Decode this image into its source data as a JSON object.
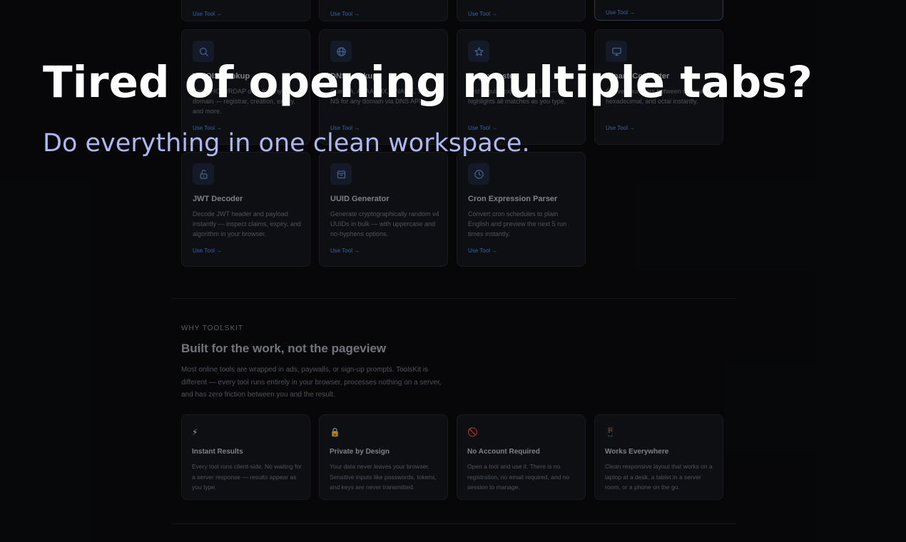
{
  "overlay": {
    "headline": "Tired of opening multiple tabs?",
    "subheadline": "Do everything in one clean workspace."
  },
  "tools": {
    "cta": "Use Tool →",
    "cards": [
      {
        "title": "",
        "description": "",
        "icon": "",
        "cta": "Use Tool →"
      },
      {
        "title": "",
        "description": "",
        "icon": "",
        "cta": "Use Tool →"
      },
      {
        "title": "",
        "description": "",
        "icon": "",
        "cta": "Use Tool →"
      },
      {
        "title": "",
        "description": "",
        "icon": "",
        "cta": "Use Tool →"
      },
      {
        "title": "WHOIS Lookup",
        "description": "Get WHOIS/RDAP data for any domain — registrar, creation, expiry, and more.",
        "icon": "search-icon",
        "cta": "Use Tool →"
      },
      {
        "title": "DNS Lookup",
        "description": "Query A, AAAA, MX, CNAME, TXT, NS for any domain via DNS API.",
        "icon": "globe-icon",
        "cta": "Use Tool →"
      },
      {
        "title": "Regex Tester",
        "description": "Test regular expressions live — highlights all matches as you type.",
        "icon": "star-icon",
        "cta": "Use Tool →"
      },
      {
        "title": "Binary Converter",
        "description": "Convert numbers between decimal, hexadecimal, and octal instantly.",
        "icon": "monitor-icon",
        "cta": "Use Tool →"
      },
      {
        "title": "JWT Decoder",
        "description": "Decode JWT header and payload instantly — inspect claims, expiry, and algorithm in your browser.",
        "icon": "unlock-icon",
        "cta": "Use Tool →"
      },
      {
        "title": "UUID Generator",
        "description": "Generate cryptographically random v4 UUIDs in bulk — with uppercase and no-hyphens options.",
        "icon": "archive-icon",
        "cta": "Use Tool →"
      },
      {
        "title": "Cron Expression Parser",
        "description": "Convert cron schedules to plain English and preview the next 5 run times instantly.",
        "icon": "clock-icon",
        "cta": "Use Tool →"
      }
    ]
  },
  "why": {
    "eyebrow": "WHY TOOLSKIT",
    "title": "Built for the work, not the pageview",
    "body": "Most online tools are wrapped in ads, paywalls, or sign-up prompts. ToolsKit is different — every tool runs entirely in your browser, processes nothing on a server, and has zero friction between you and the result.",
    "features": [
      {
        "emoji": "⚡",
        "icon": "lightning-icon",
        "title": "Instant Results",
        "description": "Every tool runs client-side. No waiting for a server response — results appear as you type."
      },
      {
        "emoji": "🔒",
        "icon": "lock-icon",
        "title": "Private by Design",
        "description": "Your data never leaves your browser. Sensitive inputs like passwords, tokens, and keys are never transmitted."
      },
      {
        "emoji": "🚫",
        "icon": "no-entry-icon",
        "title": "No Account Required",
        "description": "Open a tool and use it. There is no registration, no email required, and no session to manage."
      },
      {
        "emoji": "📱",
        "icon": "mobile-icon",
        "title": "Works Everywhere",
        "description": "Clean responsive layout that works on a laptop at a desk, a tablet in a server room, or a phone on the go."
      }
    ]
  },
  "colors": {
    "background": "#0a0b0d",
    "card": "#14161b",
    "accent": "#4f86d8",
    "headline": "#ffffff",
    "subheadline": "#aeb8f0"
  }
}
